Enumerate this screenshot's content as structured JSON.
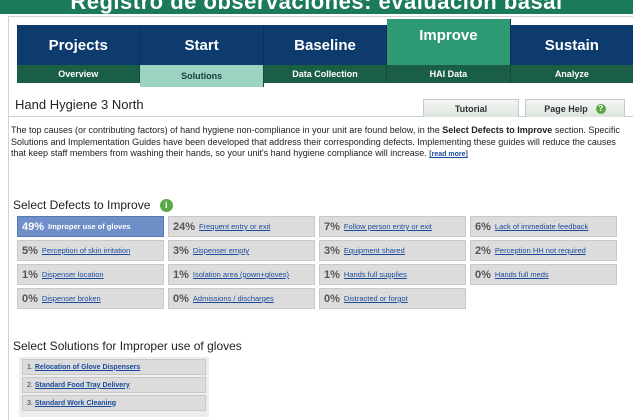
{
  "page_heading": "Registro de observaciones: evaluación basal",
  "top_nav": [
    {
      "label": "Projects",
      "active": false
    },
    {
      "label": "Start",
      "active": false
    },
    {
      "label": "Baseline",
      "active": false
    },
    {
      "label": "Improve",
      "active": true
    },
    {
      "label": "Sustain",
      "active": false
    }
  ],
  "sub_nav": [
    {
      "label": "Overview",
      "active": false
    },
    {
      "label": "Solutions",
      "active": true
    },
    {
      "label": "Data Collection",
      "active": false
    },
    {
      "label": "HAI Data",
      "active": false
    },
    {
      "label": "Analyze",
      "active": false
    }
  ],
  "title_bar": {
    "title": "Hand Hygiene  3 North",
    "tutorial_label": "Tutorial",
    "help_label": "Page Help",
    "help_icon": "?"
  },
  "intro": {
    "text_a": "The top causes (or contributing factors) of hand hygiene non-compliance in your unit are found below, in the ",
    "text_bold": "Select Defects to Improve",
    "text_b": " section. Specific Solutions and Implementation Guides have been developed that address their corresponding defects. Implementing these guides will reduce the causes that keep staff members from washing their hands, so your unit's hand hygiene compliance will increase. ",
    "read_more": "[read more]"
  },
  "defects_title": "Select Defects to Improve",
  "info_icon": "i",
  "defects": [
    {
      "pct": "49%",
      "label": "Improper use of gloves",
      "selected": true
    },
    {
      "pct": "24%",
      "label": "Frequent entry or exit",
      "selected": false
    },
    {
      "pct": "7%",
      "label": "Follow person entry or exit",
      "selected": false
    },
    {
      "pct": "6%",
      "label": "Lack of immediate feedback",
      "selected": false
    },
    {
      "pct": "5%",
      "label": "Perception of skin irritation",
      "selected": false
    },
    {
      "pct": "3%",
      "label": "Dispenser empty",
      "selected": false
    },
    {
      "pct": "3%",
      "label": "Equipment shared",
      "selected": false
    },
    {
      "pct": "2%",
      "label": "Perception HH not required",
      "selected": false
    },
    {
      "pct": "1%",
      "label": "Dispenser location",
      "selected": false
    },
    {
      "pct": "1%",
      "label": "Isolation area (gown+gloves)",
      "selected": false
    },
    {
      "pct": "1%",
      "label": "Hands full supplies",
      "selected": false
    },
    {
      "pct": "0%",
      "label": "Hands full meds",
      "selected": false
    },
    {
      "pct": "0%",
      "label": "Dispenser broken",
      "selected": false
    },
    {
      "pct": "0%",
      "label": "Admissions / discharges",
      "selected": false
    },
    {
      "pct": "0%",
      "label": "Distracted or forgot",
      "selected": false
    }
  ],
  "solutions_title": "Select Solutions for Improper use of gloves",
  "solutions": [
    {
      "num": "1.",
      "label": "Relocation of Glove Dispensers"
    },
    {
      "num": "2.",
      "label": "Standard Food Tray Delivery"
    },
    {
      "num": "3.",
      "label": "Standard Work Cleaning"
    }
  ],
  "colors": {
    "nav_blue": "#0d3b6e",
    "nav_green_active": "#2e9a73",
    "subnav_green": "#1a5e45",
    "subnav_active": "#9dd3c3",
    "defect_selected": "#6f8fc9",
    "link_blue": "#1a4a9a"
  }
}
